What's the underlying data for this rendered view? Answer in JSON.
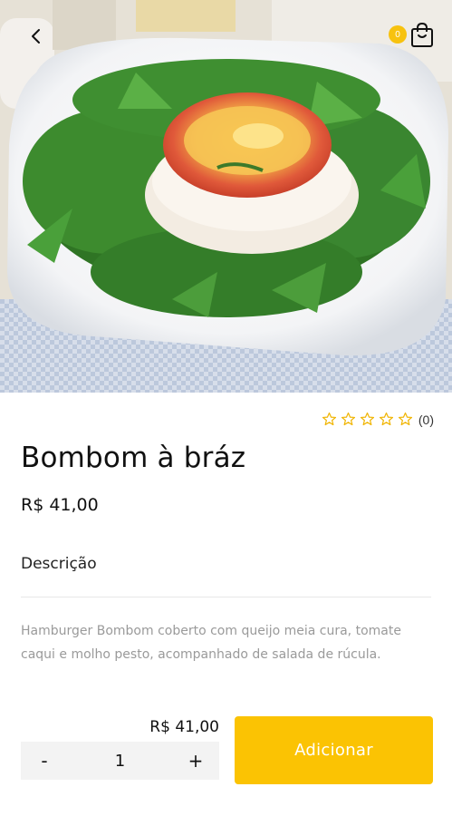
{
  "header": {
    "back_icon": "chevron-left-icon",
    "cart_icon": "shopping-bag-icon",
    "cart_count": "0",
    "badge_color": "#f7c20f"
  },
  "product": {
    "image_alt": "",
    "name": "Bombom à bráz",
    "price": "R$ 41,00",
    "rating": {
      "stars": 0,
      "max_stars": 5,
      "count_label": "(0)",
      "star_color": "#f0b400"
    },
    "description_heading": "Descrição",
    "description": "Hamburger Bombom coberto com queijo meia cura, tomate caqui e molho pesto, acompanhado de salada de rúcula."
  },
  "order": {
    "total": "R$ 41,00",
    "quantity": "1",
    "decrement_label": "-",
    "increment_label": "+",
    "add_button_label": "Adicionar",
    "accent_color": "#fbc303"
  }
}
